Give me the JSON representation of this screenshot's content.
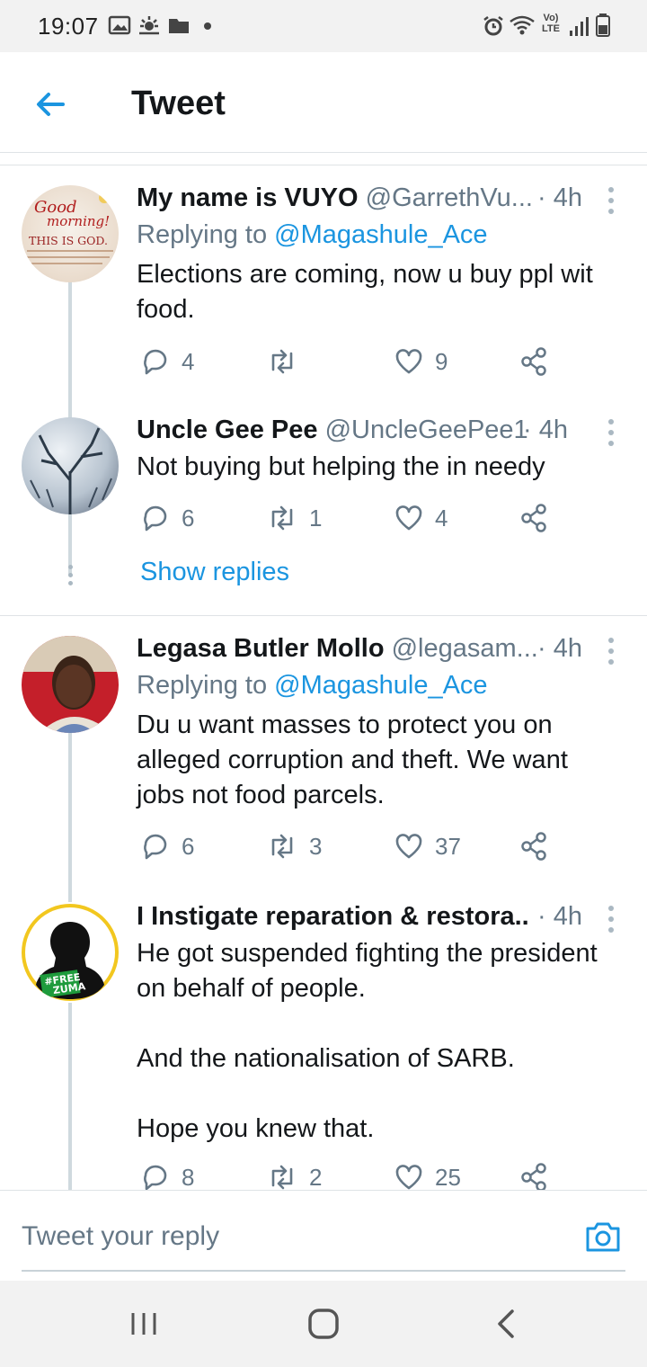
{
  "status_bar": {
    "time": "19:07",
    "icons_left": [
      "image-icon",
      "weather-icon",
      "folder-icon",
      "dot-icon"
    ],
    "icons_right": [
      "alarm-icon",
      "wifi-icon",
      "volte-icon",
      "signal-icon",
      "battery-icon"
    ],
    "volte_label": "Vo) LTE"
  },
  "header": {
    "title": "Tweet",
    "back_icon": "arrow-left-icon"
  },
  "tweets": [
    {
      "name": "My name is VUYO",
      "handle": "@GarrethVu...",
      "time": "· 4h",
      "replying_prefix": "Replying to ",
      "replying_to": "@Magashule_Ace",
      "text": "Elections are coming, now u buy ppl wit food.",
      "replies": "4",
      "retweets": "",
      "likes": "9",
      "avatar_text": [
        "Good",
        "morning!",
        "THIS IS GOD."
      ]
    },
    {
      "name": "Uncle Gee Pee",
      "handle": "@UncleGeePee1",
      "time": "· 4h",
      "text": "Not buying but helping the in needy",
      "replies": "6",
      "retweets": "1",
      "likes": "4"
    },
    {
      "name": "Legasa Butler Mollo",
      "handle": "@legasam...",
      "time": "· 4h",
      "replying_prefix": "Replying to ",
      "replying_to": "@Magashule_Ace",
      "text": "Du u want masses to protect you on alleged corruption and theft. We want jobs not food parcels.",
      "replies": "6",
      "retweets": "3",
      "likes": "37"
    },
    {
      "name": "I Instigate reparation & restora...",
      "handle": "",
      "time": "· 4h",
      "text": "He got suspended fighting the president on behalf of people.\n\nAnd the nationalisation of SARB.\n\nHope you knew that.",
      "replies": "8",
      "retweets": "2",
      "likes": "25",
      "avatar_text": [
        "#FREE",
        "ZUMA"
      ]
    }
  ],
  "show_replies": "Show replies",
  "reply_bar": {
    "placeholder": "Tweet your reply",
    "camera_icon": "camera-icon"
  },
  "nav_bar": {
    "buttons": [
      "recents-icon",
      "home-icon",
      "back-icon"
    ]
  },
  "colors": {
    "link": "#1b95e0",
    "secondary": "#657786",
    "primary_text": "#14171a"
  }
}
